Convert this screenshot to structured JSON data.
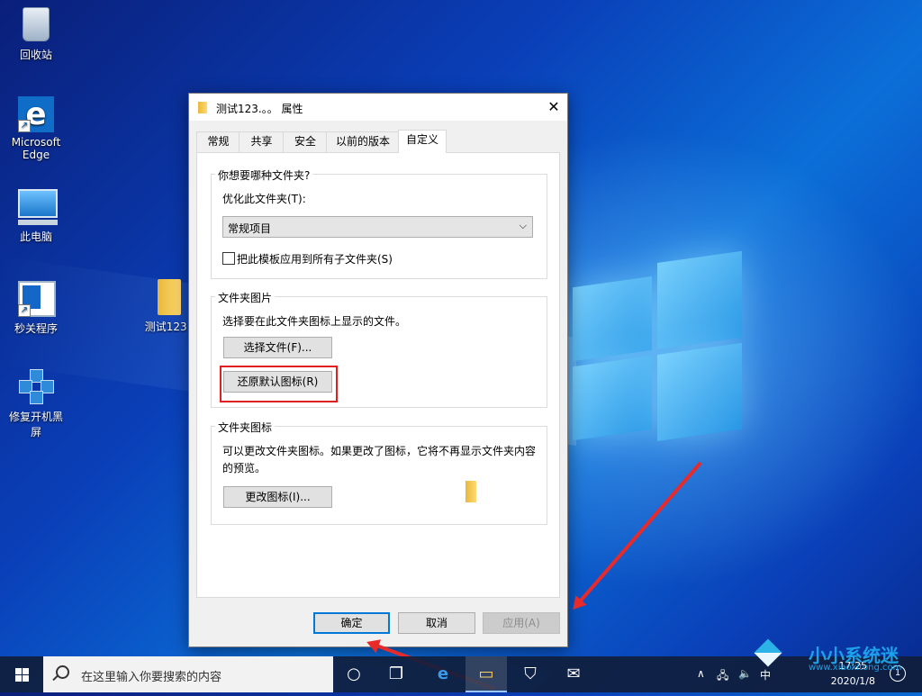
{
  "desktop": {
    "icons": [
      {
        "label": "回收站"
      },
      {
        "label": "Microsoft Edge"
      },
      {
        "label": "此电脑"
      },
      {
        "label": "秒关程序"
      },
      {
        "label": "测试123.."
      },
      {
        "label": "修复开机黑屏"
      }
    ]
  },
  "dialog": {
    "title": "测试123.。。 属性",
    "close_glyph": "✕",
    "tabs": [
      "常规",
      "共享",
      "安全",
      "以前的版本",
      "自定义"
    ],
    "active_tab": "自定义",
    "group1": {
      "label": "你想要哪种文件夹?",
      "optimize_label": "优化此文件夹(T):",
      "optimize_value": "常规项目",
      "apply_sub_label": "把此模板应用到所有子文件夹(S)"
    },
    "group2": {
      "label": "文件夹图片",
      "description": "选择要在此文件夹图标上显示的文件。",
      "choose_file_button": "选择文件(F)...",
      "restore_default_button": "还原默认图标(R)"
    },
    "group3": {
      "label": "文件夹图标",
      "description_line1": "可以更改文件夹图标。如果更改了图标，它将不再显示文件夹内容",
      "description_line2": "的预览。",
      "change_icon_button": "更改图标(I)..."
    },
    "buttons": {
      "ok": "确定",
      "cancel": "取消",
      "apply": "应用(A)"
    }
  },
  "taskbar": {
    "search_placeholder": "在这里输入你要搜索的内容",
    "time": "17:25",
    "date": "2020/1/8",
    "notification_count": "1"
  },
  "watermark": {
    "title": "小小系统迷",
    "url": "www.xiaoxitong.com"
  },
  "colors": {
    "highlight_box": "#e02020",
    "arrows": "#e82a2a",
    "primary_button_border": "#0078d7"
  }
}
